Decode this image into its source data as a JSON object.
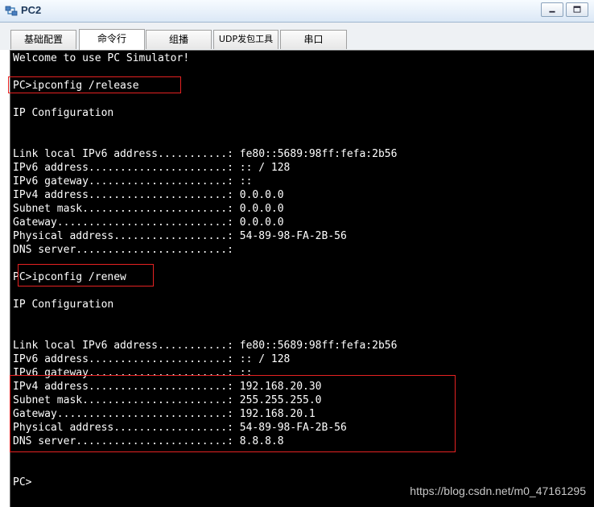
{
  "window": {
    "title": "PC2",
    "icon": "pc-network-icon",
    "buttons": [
      "minimize",
      "maximize"
    ]
  },
  "tabs": [
    {
      "label": "基础配置",
      "active": false
    },
    {
      "label": "命令行",
      "active": true
    },
    {
      "label": "组播",
      "active": false
    },
    {
      "label": "UDP发包工具",
      "active": false
    },
    {
      "label": "串口",
      "active": false
    }
  ],
  "terminal": {
    "lines": [
      "Welcome to use PC Simulator!",
      "",
      "PC>ipconfig /release",
      "",
      "IP Configuration",
      "",
      "",
      "Link local IPv6 address...........: fe80::5689:98ff:fefa:2b56",
      "IPv6 address......................: :: / 128",
      "IPv6 gateway......................: ::",
      "IPv4 address......................: 0.0.0.0",
      "Subnet mask.......................: 0.0.0.0",
      "Gateway...........................: 0.0.0.0",
      "Physical address..................: 54-89-98-FA-2B-56",
      "DNS server........................:",
      "",
      "PC>ipconfig /renew",
      "",
      "IP Configuration",
      "",
      "",
      "Link local IPv6 address...........: fe80::5689:98ff:fefa:2b56",
      "IPv6 address......................: :: / 128",
      "IPv6 gateway......................: ::",
      "IPv4 address......................: 192.168.20.30",
      "Subnet mask.......................: 255.255.255.0",
      "Gateway...........................: 192.168.20.1",
      "Physical address..................: 54-89-98-FA-2B-56",
      "DNS server........................: 8.8.8.8",
      "",
      "",
      "PC>"
    ]
  },
  "watermark": "https://blog.csdn.net/m0_47161295",
  "colors": {
    "terminal_bg": "#000000",
    "terminal_fg": "#ffffff",
    "annotation": "#e52222"
  }
}
